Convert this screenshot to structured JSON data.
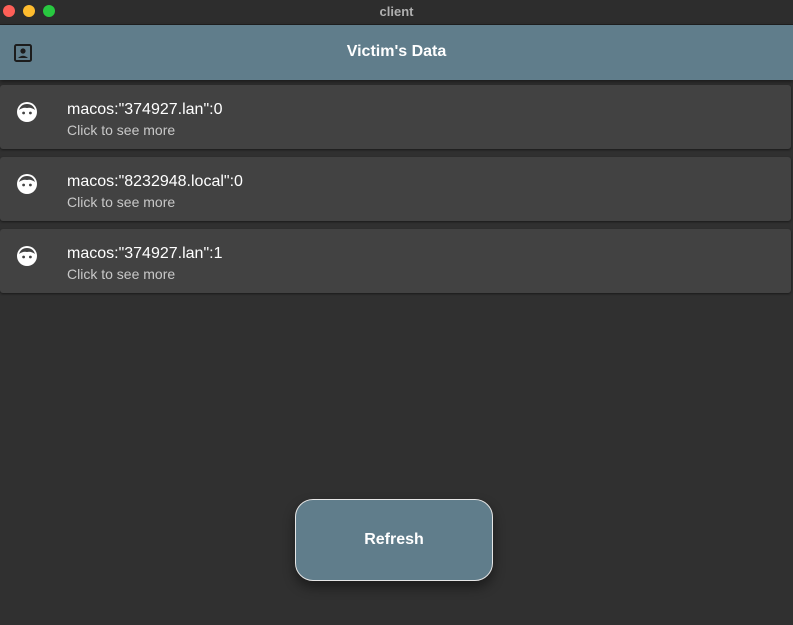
{
  "window": {
    "title": "client"
  },
  "appbar": {
    "title": "Victim's Data",
    "leading_icon": "account-box-icon",
    "color": "#607d8b"
  },
  "victims": [
    {
      "title": "macos:\"374927.lan\":0",
      "subtitle": "Click to see more",
      "icon": "face-icon"
    },
    {
      "title": "macos:\"8232948.local\":0",
      "subtitle": "Click to see more",
      "icon": "face-icon"
    },
    {
      "title": "macos:\"374927.lan\":1",
      "subtitle": "Click to see more",
      "icon": "face-icon"
    }
  ],
  "refresh_button": {
    "label": "Refresh"
  }
}
